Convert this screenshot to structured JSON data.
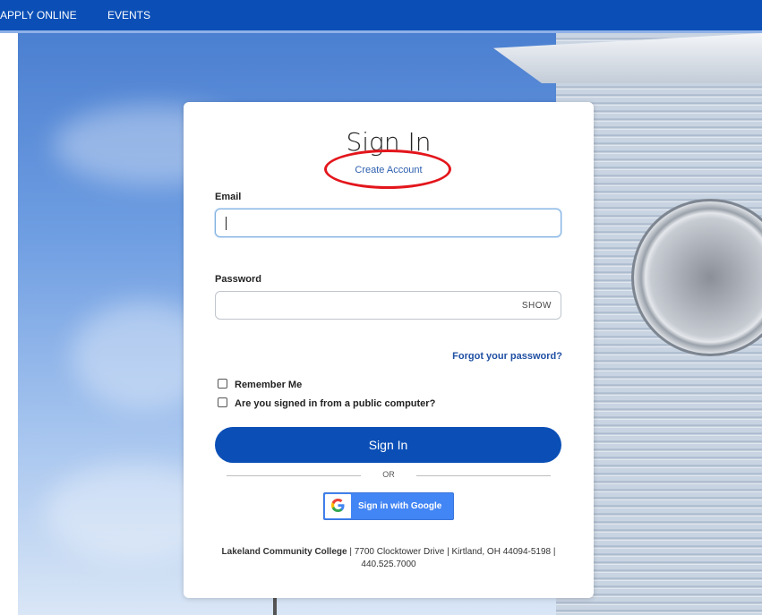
{
  "nav": {
    "items": [
      {
        "label": "APPLY ONLINE"
      },
      {
        "label": "EVENTS"
      }
    ],
    "bg_color": "#0b4fb6"
  },
  "login": {
    "title": "Sign In",
    "create_account": "Create Account",
    "email_label": "Email",
    "email_value": "",
    "password_label": "Password",
    "password_value": "",
    "show_toggle": "SHOW",
    "forgot_password": "Forgot your password?",
    "remember_me": "Remember Me",
    "public_computer": "Are you signed in from a public computer?",
    "signin_button": "Sign In",
    "or_text": "OR",
    "google_button": "Sign in with Google",
    "google_glyph": "G",
    "accent_color": "#0b4fb6",
    "annotation_color": "#e3161c"
  },
  "footer": {
    "college": "Lakeland Community College",
    "address": " | 7700 Clocktower Drive | Kirtland, OH 44094-5198 | 440.525.7000"
  }
}
